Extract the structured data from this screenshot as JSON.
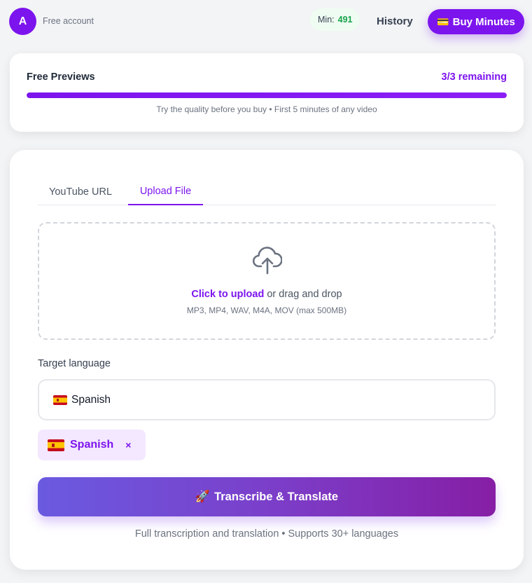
{
  "header": {
    "avatar_initial": "A",
    "account_type": "Free account",
    "minutes_label": "Min:",
    "minutes_value": "491",
    "history_label": "History",
    "buy_label": "Buy Minutes",
    "buy_icon": "credit-card-icon"
  },
  "preview": {
    "title": "Free Previews",
    "remaining": "3/3 remaining",
    "progress_fraction": 1.0,
    "note": "Try the quality before you buy • First 5 minutes of any video"
  },
  "tabs": [
    {
      "label": "YouTube URL",
      "active": false
    },
    {
      "label": "Upload File",
      "active": true
    }
  ],
  "dropzone": {
    "icon": "cloud-upload-icon",
    "link_text": "Click to upload",
    "rest_text": " or drag and drop",
    "formats": "MP3, MP4, WAV, M4A, MOV (max 500MB)"
  },
  "language": {
    "label": "Target language",
    "selected": "Spanish",
    "flag_icon": "spain-flag-icon",
    "chips": [
      {
        "label": "Spanish",
        "remove": "×"
      }
    ]
  },
  "action": {
    "label": "Transcribe & Translate",
    "icon": "rocket-icon",
    "note": "Full transcription and translation • Supports 30+ languages"
  },
  "colors": {
    "accent": "#7c14ee",
    "minutes_green": "#16a34a",
    "chip_bg": "#f3e8ff",
    "button_gradient_start": "#6a5ae0",
    "button_gradient_end": "#861ea5"
  }
}
